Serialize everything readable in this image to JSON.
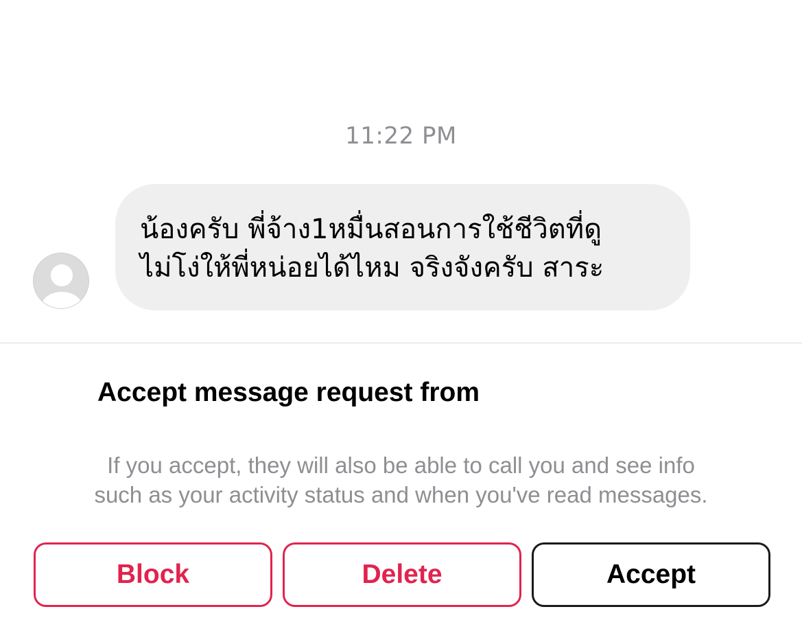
{
  "conversation": {
    "timestamp": "11:22 PM",
    "message": {
      "lines": [
        "น้องครับ พี่จ้าง1หมื่นสอนการใช้ชีวิตที่ดู",
        "ไม่โง่ให้พี่หน่อยได้ไหม จริงจังครับ สาระ"
      ]
    },
    "sender_avatar_icon": "default-profile-icon"
  },
  "request": {
    "title": "Accept message request from",
    "info_lines": [
      "If you accept, they will also be able to call you and see info",
      "such as your activity status and when you've read messages."
    ]
  },
  "actions": {
    "block_label": "Block",
    "delete_label": "Delete",
    "accept_label": "Accept"
  },
  "colors": {
    "danger": "#e0244e",
    "bubble": "#efefef",
    "secondary_text": "#8e8e93"
  }
}
